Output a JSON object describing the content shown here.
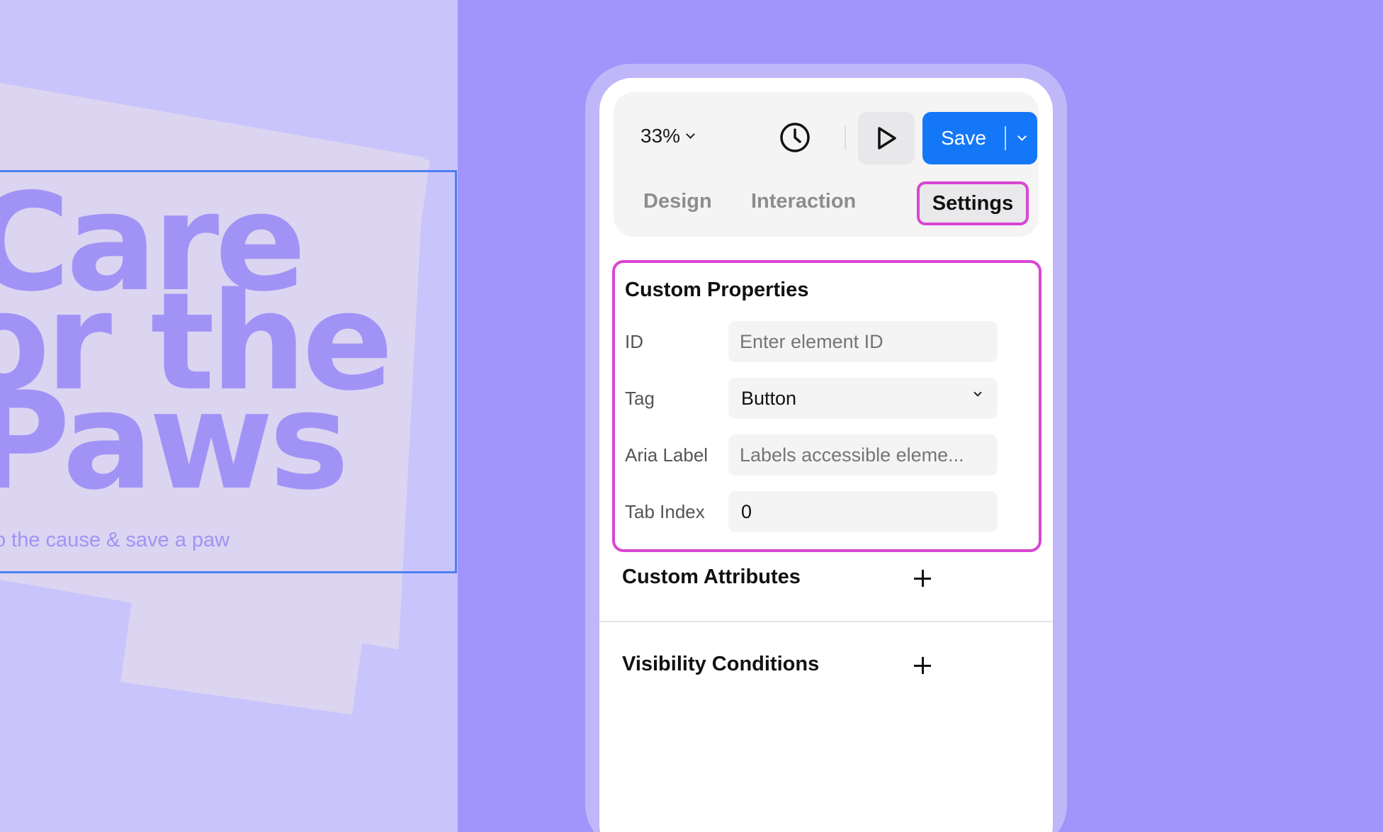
{
  "canvas": {
    "hero_lines": [
      "Care",
      "or the",
      "Paws"
    ],
    "subtitle": "o the cause & save a paw"
  },
  "toolbar": {
    "zoom_level": "33%",
    "history_icon": "clock-icon",
    "play_icon": "play-icon",
    "save_label": "Save"
  },
  "tabs": [
    {
      "label": "Design",
      "active": false
    },
    {
      "label": "Interaction",
      "active": false
    },
    {
      "label": "Settings",
      "active": true
    }
  ],
  "custom_properties": {
    "title": "Custom Properties",
    "fields": [
      {
        "label": "ID",
        "value": "",
        "placeholder": "Enter element ID"
      },
      {
        "label": "Tag",
        "value": "Button",
        "type": "select"
      },
      {
        "label": "Aria Label",
        "value": "",
        "placeholder": "Labels accessible eleme..."
      },
      {
        "label": "Tab Index",
        "value": "0"
      }
    ]
  },
  "sections": [
    {
      "title": "Custom Attributes",
      "action_icon": "plus-icon"
    },
    {
      "title": "Visibility Conditions",
      "action_icon": "plus-icon"
    }
  ],
  "colors": {
    "accent": "#1477f8",
    "highlight": "#d946d3",
    "background": "#a194fb",
    "selection": "#4e7fef"
  }
}
